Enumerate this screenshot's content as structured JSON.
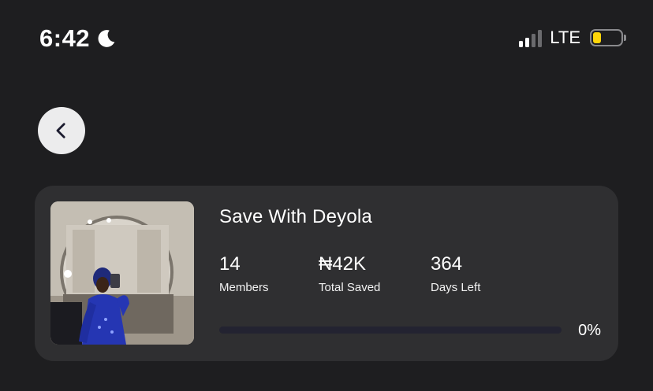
{
  "status_bar": {
    "time": "6:42",
    "network": "LTE",
    "icons": [
      "moon-icon",
      "signal-icon",
      "battery-icon"
    ],
    "battery_color": "#ffd60a"
  },
  "header": {
    "back_icon": "chevron-left-icon"
  },
  "group_card": {
    "title": "Save With Deyola",
    "stats": {
      "members": {
        "value": "14",
        "label": "Members"
      },
      "total_saved": {
        "value": "₦42K",
        "label": "Total Saved"
      },
      "days_left": {
        "value": "364",
        "label": "Days Left"
      }
    },
    "progress": {
      "fraction": 0,
      "text": "0%"
    }
  },
  "colors": {
    "background": "#1e1e20",
    "card": "#2f2f31",
    "track": "#232331",
    "back_button": "#ececed"
  }
}
